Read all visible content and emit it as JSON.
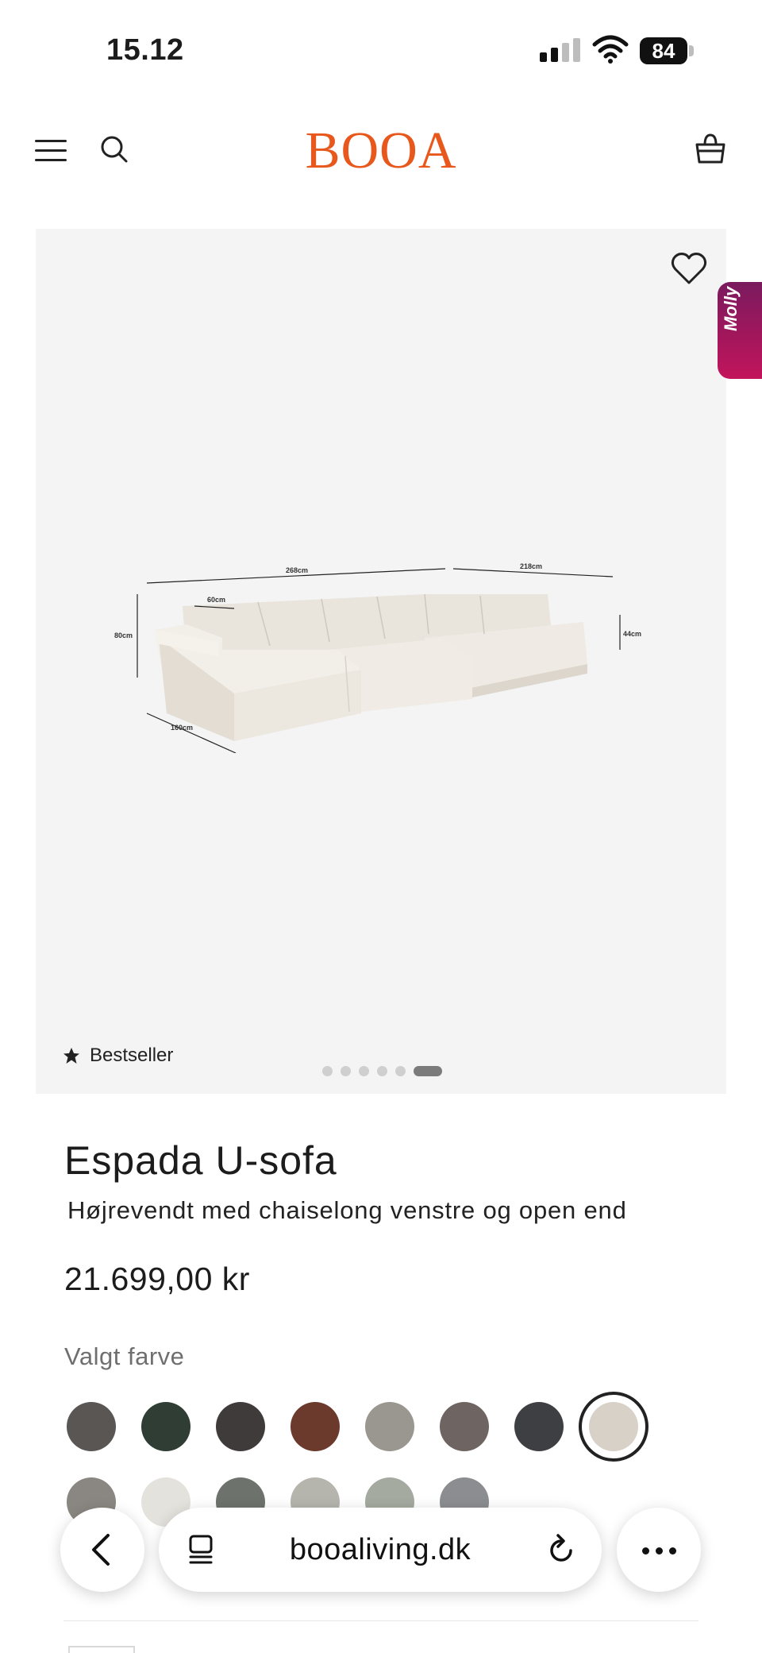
{
  "status_bar": {
    "time": "15.12",
    "battery": "84",
    "signal_icon": "cellular-signal-icon",
    "wifi_icon": "wifi-icon"
  },
  "header": {
    "logo": "BOOA",
    "brand_color": "#e8581d",
    "menu_icon": "hamburger-menu-icon",
    "search_icon": "search-icon",
    "cart_icon": "basket-icon"
  },
  "gallery": {
    "badge": "Bestseller",
    "badge_icon": "star-icon",
    "wishlist_icon": "heart-icon",
    "dimensions": {
      "back_length": "268cm",
      "side_length": "218cm",
      "arm_depth": "60cm",
      "height": "80cm",
      "chaise_length": "160cm",
      "seat_height": "44cm"
    },
    "slide_count": 6,
    "active_slide": 6
  },
  "assistant": {
    "label": "Molly",
    "color_top": "#7a1a5e",
    "color_bottom": "#c2145b"
  },
  "product": {
    "title": "Espada U-sofa",
    "subtitle": "Højrevendt med chaiselong venstre og open end",
    "price": "21.699,00 kr",
    "color_label": "Valgt farve",
    "swatches_row1": [
      "#5a5654",
      "#2f3d35",
      "#403b3b",
      "#6b3a2c",
      "#9a9790",
      "#6e6461",
      "#3e3f42",
      "#d8d1c7"
    ],
    "swatches_row2": [
      "#8a8681",
      "#e4e2dc",
      "#6d726c",
      "#b5b4ad",
      "#a4aaa0",
      "#8b8d90"
    ],
    "selected_swatch": 8
  },
  "browser": {
    "url": "booaliving.dk",
    "back_icon": "chevron-left-icon",
    "tabs_icon": "tabs-icon",
    "reload_icon": "reload-icon",
    "more_icon": "more-dots-icon"
  }
}
